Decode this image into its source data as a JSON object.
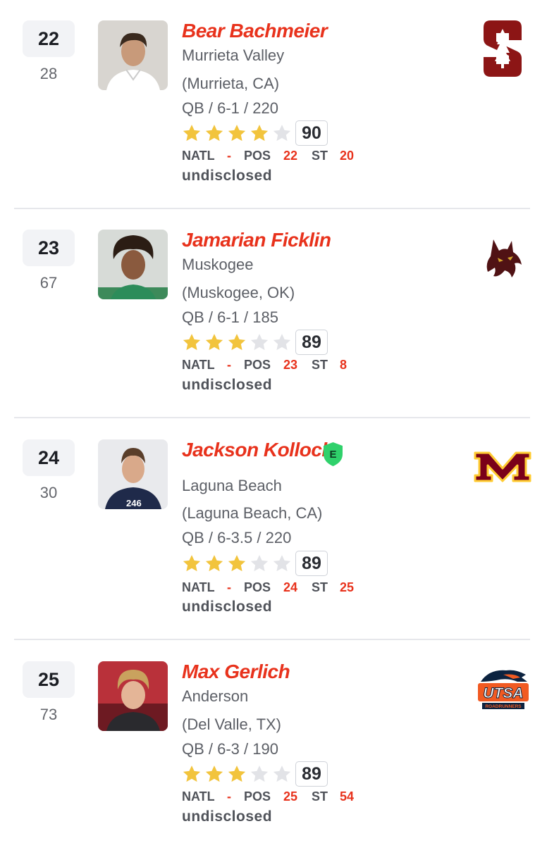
{
  "players": [
    {
      "rank": "22",
      "prev_rank": "28",
      "name": "Bear Bachmeier",
      "school": "Murrieta Valley",
      "hometown": "(Murrieta, CA)",
      "pos_ht_wt": "QB / 6-1 / 220",
      "stars": 4,
      "rating": "90",
      "natl_label": "NATL",
      "natl": "-",
      "pos_label": "POS",
      "pos": "22",
      "st_label": "ST",
      "st": "20",
      "status": "undisclosed",
      "team_logo": "stanford-logo",
      "photo_bg": "#d6d3cf",
      "accent": "#8c1515"
    },
    {
      "rank": "23",
      "prev_rank": "67",
      "name": "Jamarian Ficklin",
      "school": "Muskogee",
      "hometown": "(Muskogee, OK)",
      "pos_ht_wt": "QB / 6-1 / 185",
      "stars": 3,
      "rating": "89",
      "natl_label": "NATL",
      "natl": "-",
      "pos_label": "POS",
      "pos": "23",
      "st_label": "ST",
      "st": "8",
      "status": "undisclosed",
      "team_logo": "texas-state-bobcat-logo",
      "photo_bg": "#cfd6d2",
      "accent": "#501214"
    },
    {
      "rank": "24",
      "prev_rank": "30",
      "name": "Jackson Kollock",
      "school": "Laguna Beach",
      "hometown": "(Laguna Beach, CA)",
      "pos_ht_wt": "QB / 6-3.5 / 220",
      "stars": 3,
      "rating": "89",
      "natl_label": "NATL",
      "natl": "-",
      "pos_label": "POS",
      "pos": "24",
      "st_label": "ST",
      "st": "25",
      "status": "undisclosed",
      "badge": "E",
      "team_logo": "minnesota-logo",
      "photo_bg": "#e8e9ec",
      "accent": "#7a0019"
    },
    {
      "rank": "25",
      "prev_rank": "73",
      "name": "Max Gerlich",
      "school": "Anderson",
      "hometown": "(Del Valle, TX)",
      "pos_ht_wt": "QB / 6-3 / 190",
      "stars": 3,
      "rating": "89",
      "natl_label": "NATL",
      "natl": "-",
      "pos_label": "POS",
      "pos": "25",
      "st_label": "ST",
      "st": "54",
      "status": "undisclosed",
      "team_logo": "utsa-roadrunners-logo",
      "logo_text": "UTSA",
      "logo_subtext": "ROADRUNNERS",
      "photo_bg": "#b9313a",
      "accent": "#0c2340"
    }
  ],
  "colors": {
    "star_filled": "#f2c43d",
    "star_empty": "#e2e3e7",
    "name_red": "#e8321c",
    "badge_green": "#2fd16b"
  }
}
